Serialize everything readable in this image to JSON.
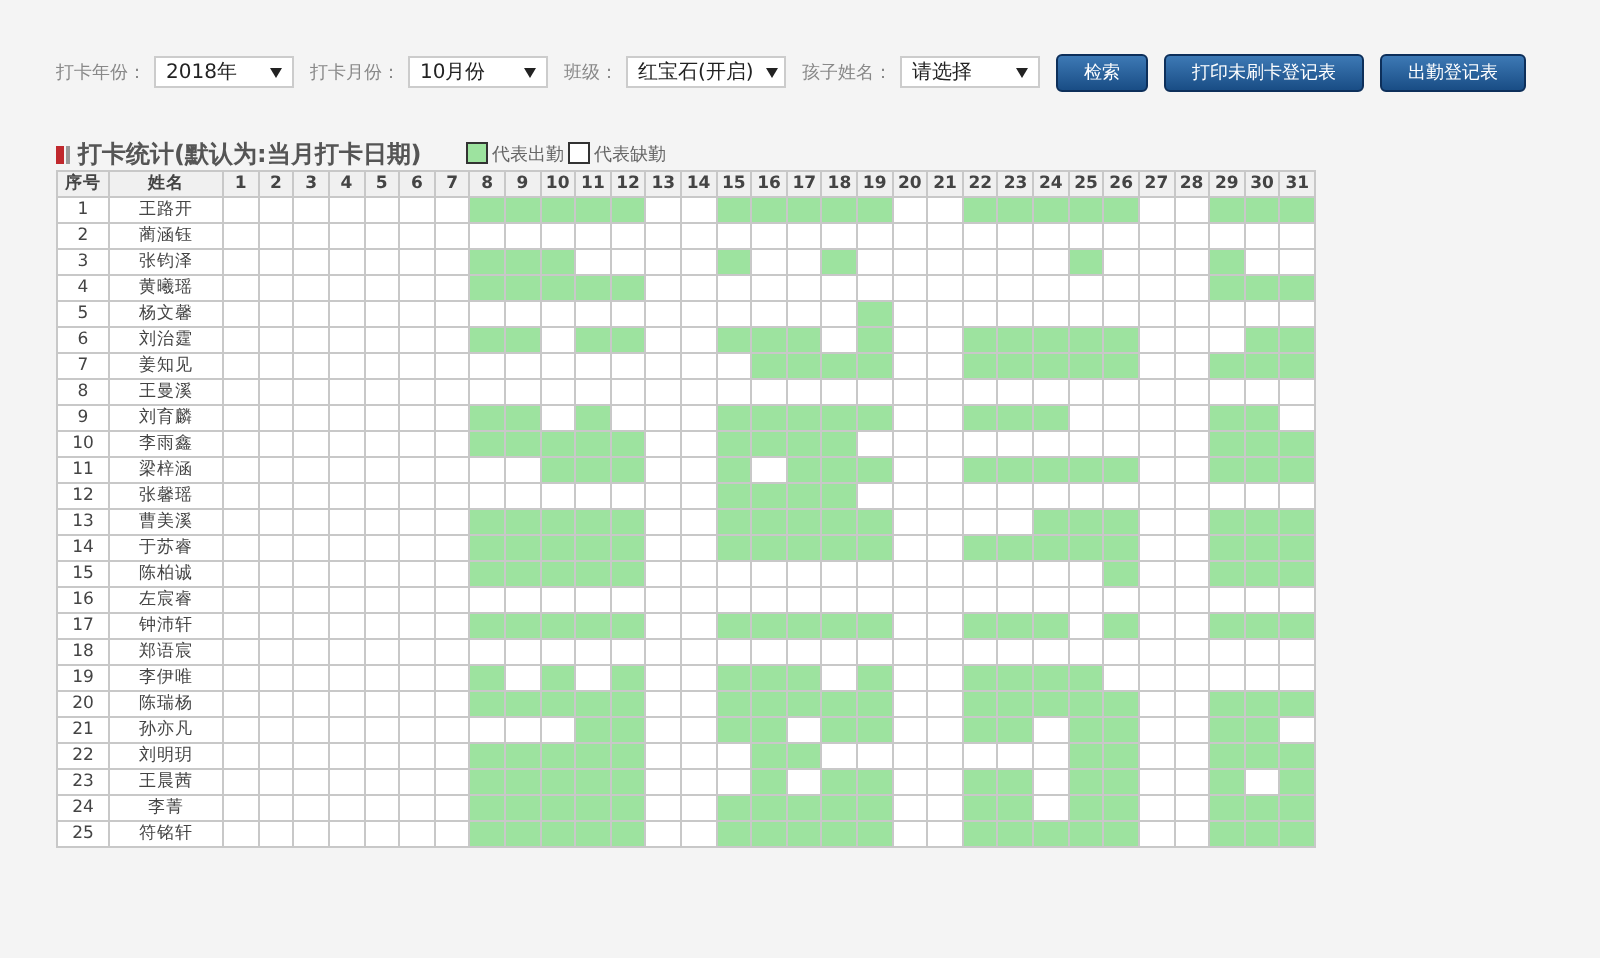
{
  "filters": [
    {
      "label": "打卡年份：",
      "value": "2018年"
    },
    {
      "label": "打卡月份：",
      "value": "10月份"
    },
    {
      "label": "班级：",
      "value": "红宝石(开启)"
    },
    {
      "label": "孩子姓名：",
      "value": "请选择"
    }
  ],
  "buttons": [
    "检索",
    "打印未刷卡登记表",
    "出勤登记表"
  ],
  "section_title": "打卡统计(默认为:当月打卡日期)",
  "legend": [
    {
      "label": "代表出勤",
      "present": true
    },
    {
      "label": "代表缺勤",
      "present": false
    }
  ],
  "table": {
    "columns": [
      "序号",
      "姓名",
      "1",
      "2",
      "3",
      "4",
      "5",
      "6",
      "7",
      "8",
      "9",
      "10",
      "11",
      "12",
      "13",
      "14",
      "15",
      "16",
      "17",
      "18",
      "19",
      "20",
      "21",
      "22",
      "23",
      "24",
      "25",
      "26",
      "27",
      "28",
      "29",
      "30",
      "31"
    ],
    "rows": [
      {
        "no": "1",
        "name": "王路开",
        "attendance": [
          false,
          false,
          false,
          false,
          false,
          false,
          false,
          true,
          true,
          true,
          true,
          true,
          false,
          false,
          true,
          true,
          true,
          true,
          true,
          false,
          false,
          true,
          true,
          true,
          true,
          true,
          false,
          false,
          true,
          true,
          true
        ]
      },
      {
        "no": "2",
        "name": "蔺涵钰",
        "attendance": [
          false,
          false,
          false,
          false,
          false,
          false,
          false,
          false,
          false,
          false,
          false,
          false,
          false,
          false,
          false,
          false,
          false,
          false,
          false,
          false,
          false,
          false,
          false,
          false,
          false,
          false,
          false,
          false,
          false,
          false,
          false
        ]
      },
      {
        "no": "3",
        "name": "张钧泽",
        "attendance": [
          false,
          false,
          false,
          false,
          false,
          false,
          false,
          true,
          true,
          true,
          false,
          false,
          false,
          false,
          true,
          false,
          false,
          true,
          false,
          false,
          false,
          false,
          false,
          false,
          true,
          false,
          false,
          false,
          true,
          false,
          false
        ]
      },
      {
        "no": "4",
        "name": "黄曦瑶",
        "attendance": [
          false,
          false,
          false,
          false,
          false,
          false,
          false,
          true,
          true,
          true,
          true,
          true,
          false,
          false,
          false,
          false,
          false,
          false,
          false,
          false,
          false,
          false,
          false,
          false,
          false,
          false,
          false,
          false,
          true,
          true,
          true
        ]
      },
      {
        "no": "5",
        "name": "杨文馨",
        "attendance": [
          false,
          false,
          false,
          false,
          false,
          false,
          false,
          false,
          false,
          false,
          false,
          false,
          false,
          false,
          false,
          false,
          false,
          false,
          true,
          false,
          false,
          false,
          false,
          false,
          false,
          false,
          false,
          false,
          false,
          false,
          false
        ]
      },
      {
        "no": "6",
        "name": "刘治霆",
        "attendance": [
          false,
          false,
          false,
          false,
          false,
          false,
          false,
          true,
          true,
          false,
          true,
          true,
          false,
          false,
          true,
          true,
          true,
          false,
          true,
          false,
          false,
          true,
          true,
          true,
          true,
          true,
          false,
          false,
          false,
          true,
          true
        ]
      },
      {
        "no": "7",
        "name": "姜知见",
        "attendance": [
          false,
          false,
          false,
          false,
          false,
          false,
          false,
          false,
          false,
          false,
          false,
          false,
          false,
          false,
          false,
          true,
          true,
          true,
          true,
          false,
          false,
          true,
          true,
          true,
          true,
          true,
          false,
          false,
          true,
          true,
          true
        ]
      },
      {
        "no": "8",
        "name": "王曼溪",
        "attendance": [
          false,
          false,
          false,
          false,
          false,
          false,
          false,
          false,
          false,
          false,
          false,
          false,
          false,
          false,
          false,
          false,
          false,
          false,
          false,
          false,
          false,
          false,
          false,
          false,
          false,
          false,
          false,
          false,
          false,
          false,
          false
        ]
      },
      {
        "no": "9",
        "name": "刘育麟",
        "attendance": [
          false,
          false,
          false,
          false,
          false,
          false,
          false,
          true,
          true,
          false,
          true,
          false,
          false,
          false,
          true,
          true,
          true,
          true,
          true,
          false,
          false,
          true,
          true,
          true,
          false,
          false,
          false,
          false,
          true,
          true,
          false
        ]
      },
      {
        "no": "10",
        "name": "李雨鑫",
        "attendance": [
          false,
          false,
          false,
          false,
          false,
          false,
          false,
          true,
          true,
          true,
          true,
          true,
          false,
          false,
          true,
          true,
          true,
          true,
          false,
          false,
          false,
          false,
          false,
          false,
          false,
          false,
          false,
          false,
          true,
          true,
          true
        ]
      },
      {
        "no": "11",
        "name": "梁梓涵",
        "attendance": [
          false,
          false,
          false,
          false,
          false,
          false,
          false,
          false,
          false,
          true,
          true,
          true,
          false,
          false,
          true,
          false,
          true,
          true,
          true,
          false,
          false,
          true,
          true,
          true,
          true,
          true,
          false,
          false,
          true,
          true,
          true
        ]
      },
      {
        "no": "12",
        "name": "张馨瑶",
        "attendance": [
          false,
          false,
          false,
          false,
          false,
          false,
          false,
          false,
          false,
          false,
          false,
          false,
          false,
          false,
          true,
          true,
          true,
          true,
          false,
          false,
          false,
          false,
          false,
          false,
          false,
          false,
          false,
          false,
          false,
          false,
          false
        ]
      },
      {
        "no": "13",
        "name": "曹美溪",
        "attendance": [
          false,
          false,
          false,
          false,
          false,
          false,
          false,
          true,
          true,
          true,
          true,
          true,
          false,
          false,
          true,
          true,
          true,
          true,
          true,
          false,
          false,
          false,
          false,
          true,
          true,
          true,
          false,
          false,
          true,
          true,
          true
        ]
      },
      {
        "no": "14",
        "name": "于苏睿",
        "attendance": [
          false,
          false,
          false,
          false,
          false,
          false,
          false,
          true,
          true,
          true,
          true,
          true,
          false,
          false,
          true,
          true,
          true,
          true,
          true,
          false,
          false,
          true,
          true,
          true,
          true,
          true,
          false,
          false,
          true,
          true,
          true
        ]
      },
      {
        "no": "15",
        "name": "陈柏诚",
        "attendance": [
          false,
          false,
          false,
          false,
          false,
          false,
          false,
          true,
          true,
          true,
          true,
          true,
          false,
          false,
          false,
          false,
          false,
          false,
          false,
          false,
          false,
          false,
          false,
          false,
          false,
          true,
          false,
          false,
          true,
          true,
          true
        ]
      },
      {
        "no": "16",
        "name": "左宸睿",
        "attendance": [
          false,
          false,
          false,
          false,
          false,
          false,
          false,
          false,
          false,
          false,
          false,
          false,
          false,
          false,
          false,
          false,
          false,
          false,
          false,
          false,
          false,
          false,
          false,
          false,
          false,
          false,
          false,
          false,
          false,
          false,
          false
        ]
      },
      {
        "no": "17",
        "name": "钟沛轩",
        "attendance": [
          false,
          false,
          false,
          false,
          false,
          false,
          false,
          true,
          true,
          true,
          true,
          true,
          false,
          false,
          true,
          true,
          true,
          true,
          true,
          false,
          false,
          true,
          true,
          true,
          false,
          true,
          false,
          false,
          true,
          true,
          true
        ]
      },
      {
        "no": "18",
        "name": "郑语宸",
        "attendance": [
          false,
          false,
          false,
          false,
          false,
          false,
          false,
          false,
          false,
          false,
          false,
          false,
          false,
          false,
          false,
          false,
          false,
          false,
          false,
          false,
          false,
          false,
          false,
          false,
          false,
          false,
          false,
          false,
          false,
          false,
          false
        ]
      },
      {
        "no": "19",
        "name": "李伊唯",
        "attendance": [
          false,
          false,
          false,
          false,
          false,
          false,
          false,
          true,
          false,
          true,
          false,
          true,
          false,
          false,
          true,
          true,
          true,
          false,
          true,
          false,
          false,
          true,
          true,
          true,
          true,
          false,
          false,
          false,
          false,
          false,
          false
        ]
      },
      {
        "no": "20",
        "name": "陈瑞杨",
        "attendance": [
          false,
          false,
          false,
          false,
          false,
          false,
          false,
          true,
          true,
          true,
          true,
          true,
          false,
          false,
          true,
          true,
          true,
          true,
          true,
          false,
          false,
          true,
          true,
          true,
          true,
          true,
          false,
          false,
          true,
          true,
          true
        ]
      },
      {
        "no": "21",
        "name": "孙亦凡",
        "attendance": [
          false,
          false,
          false,
          false,
          false,
          false,
          false,
          false,
          false,
          false,
          true,
          true,
          false,
          false,
          true,
          true,
          false,
          true,
          true,
          false,
          false,
          true,
          true,
          false,
          true,
          true,
          false,
          false,
          true,
          true,
          false
        ]
      },
      {
        "no": "22",
        "name": "刘明玥",
        "attendance": [
          false,
          false,
          false,
          false,
          false,
          false,
          false,
          true,
          true,
          true,
          true,
          true,
          false,
          false,
          false,
          true,
          true,
          false,
          false,
          false,
          false,
          false,
          false,
          false,
          true,
          true,
          false,
          false,
          true,
          true,
          true
        ]
      },
      {
        "no": "23",
        "name": "王晨茜",
        "attendance": [
          false,
          false,
          false,
          false,
          false,
          false,
          false,
          true,
          true,
          true,
          true,
          true,
          false,
          false,
          false,
          true,
          false,
          true,
          true,
          false,
          false,
          true,
          true,
          false,
          true,
          true,
          false,
          false,
          true,
          false,
          true
        ]
      },
      {
        "no": "24",
        "name": "李菁",
        "attendance": [
          false,
          false,
          false,
          false,
          false,
          false,
          false,
          true,
          true,
          true,
          true,
          true,
          false,
          false,
          true,
          true,
          true,
          true,
          true,
          false,
          false,
          true,
          true,
          false,
          true,
          true,
          false,
          false,
          true,
          true,
          true
        ]
      },
      {
        "no": "25",
        "name": "符铭轩",
        "attendance": [
          false,
          false,
          false,
          false,
          false,
          false,
          false,
          true,
          true,
          true,
          true,
          true,
          false,
          false,
          true,
          true,
          true,
          true,
          true,
          false,
          false,
          true,
          true,
          true,
          true,
          true,
          false,
          false,
          true,
          true,
          true
        ]
      }
    ]
  }
}
